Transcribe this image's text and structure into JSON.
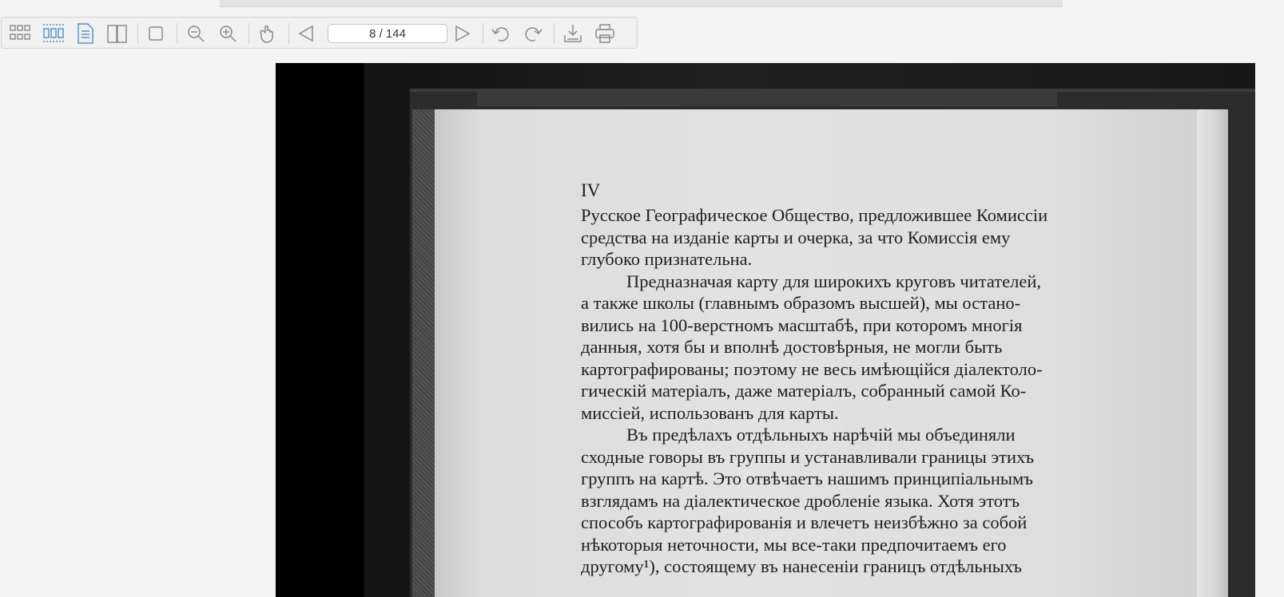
{
  "toolbar": {
    "page_indicator": "8 / 144",
    "buttons": [
      {
        "name": "thumbnails-grid-icon"
      },
      {
        "name": "continuous-scroll-icon"
      },
      {
        "name": "single-page-icon"
      },
      {
        "name": "two-page-spread-icon"
      },
      {
        "name": "fit-page-icon"
      },
      {
        "name": "zoom-out-icon"
      },
      {
        "name": "zoom-in-icon"
      },
      {
        "name": "pan-tool-icon"
      },
      {
        "name": "previous-page-icon"
      },
      {
        "name": "next-page-icon"
      },
      {
        "name": "rotate-left-icon"
      },
      {
        "name": "rotate-right-icon"
      },
      {
        "name": "download-icon"
      },
      {
        "name": "print-icon"
      }
    ],
    "accent_color": "#4a8fd6"
  },
  "document": {
    "page_heading": "IV",
    "lines": [
      "Русское Географическое Общество, предложившее Комиссіи",
      "средства на изданіе карты и очерка, за что Комиссія ему",
      "глубоко признательна.",
      "Предназначая карту для широкихъ круговъ читателей,",
      "а также школы (главнымъ образомъ высшей), мы остано-",
      "вились на 100-верстномъ масштабѣ, при которомъ многія",
      "данныя, хотя бы и вполнѣ достовѣрныя, не могли быть",
      "картографированы; поэтому не весь имѣющійся діалектоло-",
      "гическій матеріалъ, даже матеріалъ, собранный самой Ко-",
      "миссіей, использованъ для карты.",
      "Въ предѣлахъ отдѣльныхъ нарѣчій мы объединяли",
      "сходные говоры въ группы и устанавливали границы этихъ",
      "группъ на картѣ. Это отвѣчаетъ нашимъ принципіальнымъ",
      "взглядамъ на діалектическое дробленіе языка. Хотя этотъ",
      "способъ картографированія и влечетъ неизбѣжно за собой",
      "нѣкоторыя неточности, мы все-таки предпочитаемъ его",
      "другому¹), состоящему въ нанесеніи границъ отдѣльныхъ"
    ]
  }
}
